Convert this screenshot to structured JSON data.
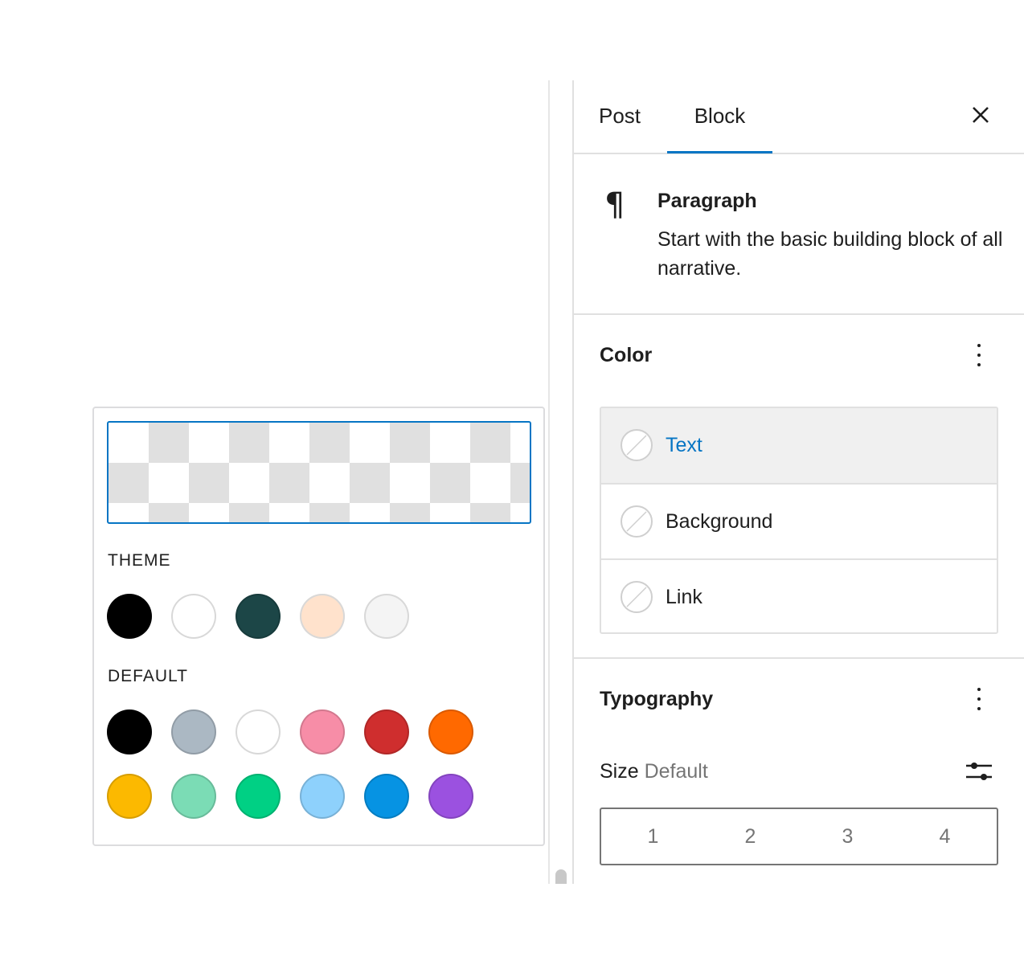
{
  "popover": {
    "theme_title": "THEME",
    "default_title": "DEFAULT",
    "theme_colors": [
      "#000000",
      "#ffffff",
      "#1c4647",
      "#ffe2cc",
      "#f4f4f4"
    ],
    "default_colors_row1": [
      "#000000",
      "#abb8c3",
      "#ffffff",
      "#f78da7",
      "#cf2e2e",
      "#ff6900"
    ],
    "default_colors_row2": [
      "#fcb900",
      "#7bdcb5",
      "#00d084",
      "#8ed1fc",
      "#0693e3",
      "#9b51e0"
    ]
  },
  "sidebar": {
    "tabs": [
      {
        "label": "Post"
      },
      {
        "label": "Block"
      }
    ],
    "close_icon": "close-icon",
    "block": {
      "icon": "paragraph-icon",
      "title": "Paragraph",
      "description": "Start with the basic building block of all narrative."
    },
    "color_panel": {
      "title": "Color",
      "items": [
        {
          "label": "Text"
        },
        {
          "label": "Background"
        },
        {
          "label": "Link"
        }
      ]
    },
    "typography_panel": {
      "title": "Typography",
      "size_label": "Size",
      "size_value": "Default",
      "size_options": [
        "1",
        "2",
        "3",
        "4"
      ]
    }
  },
  "colors": {
    "accent": "#0675c4",
    "border": "#e0e0e0",
    "active_bg": "#f0f0f0"
  }
}
